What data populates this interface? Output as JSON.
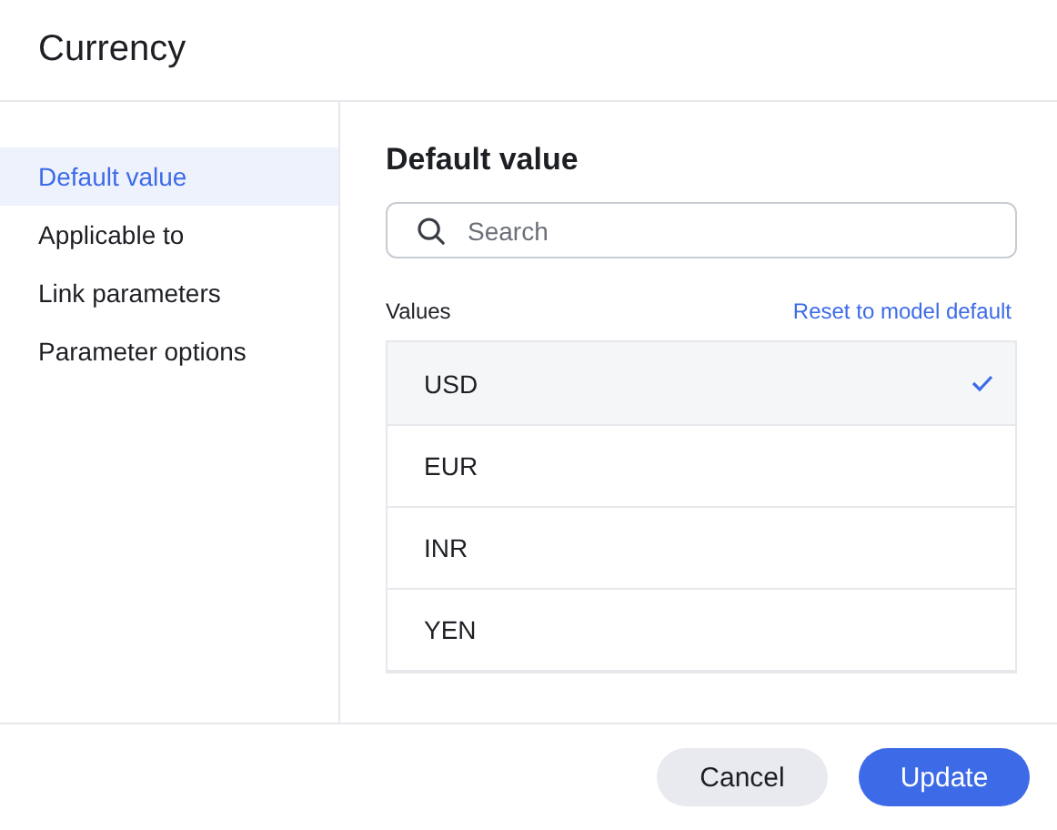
{
  "dialog": {
    "title": "Currency"
  },
  "sidebar": {
    "items": [
      {
        "label": "Default value",
        "selected": true
      },
      {
        "label": "Applicable to",
        "selected": false
      },
      {
        "label": "Link parameters",
        "selected": false
      },
      {
        "label": "Parameter options",
        "selected": false
      }
    ]
  },
  "content": {
    "heading": "Default value",
    "search": {
      "placeholder": "Search"
    },
    "values_label": "Values",
    "reset_link": "Reset to model default",
    "values": [
      {
        "label": "USD",
        "selected": true
      },
      {
        "label": "EUR",
        "selected": false
      },
      {
        "label": "INR",
        "selected": false
      },
      {
        "label": "YEN",
        "selected": false
      }
    ]
  },
  "buttons": [
    {
      "label": "Cancel",
      "kind": "secondary"
    },
    {
      "label": "Update",
      "kind": "primary"
    }
  ]
}
